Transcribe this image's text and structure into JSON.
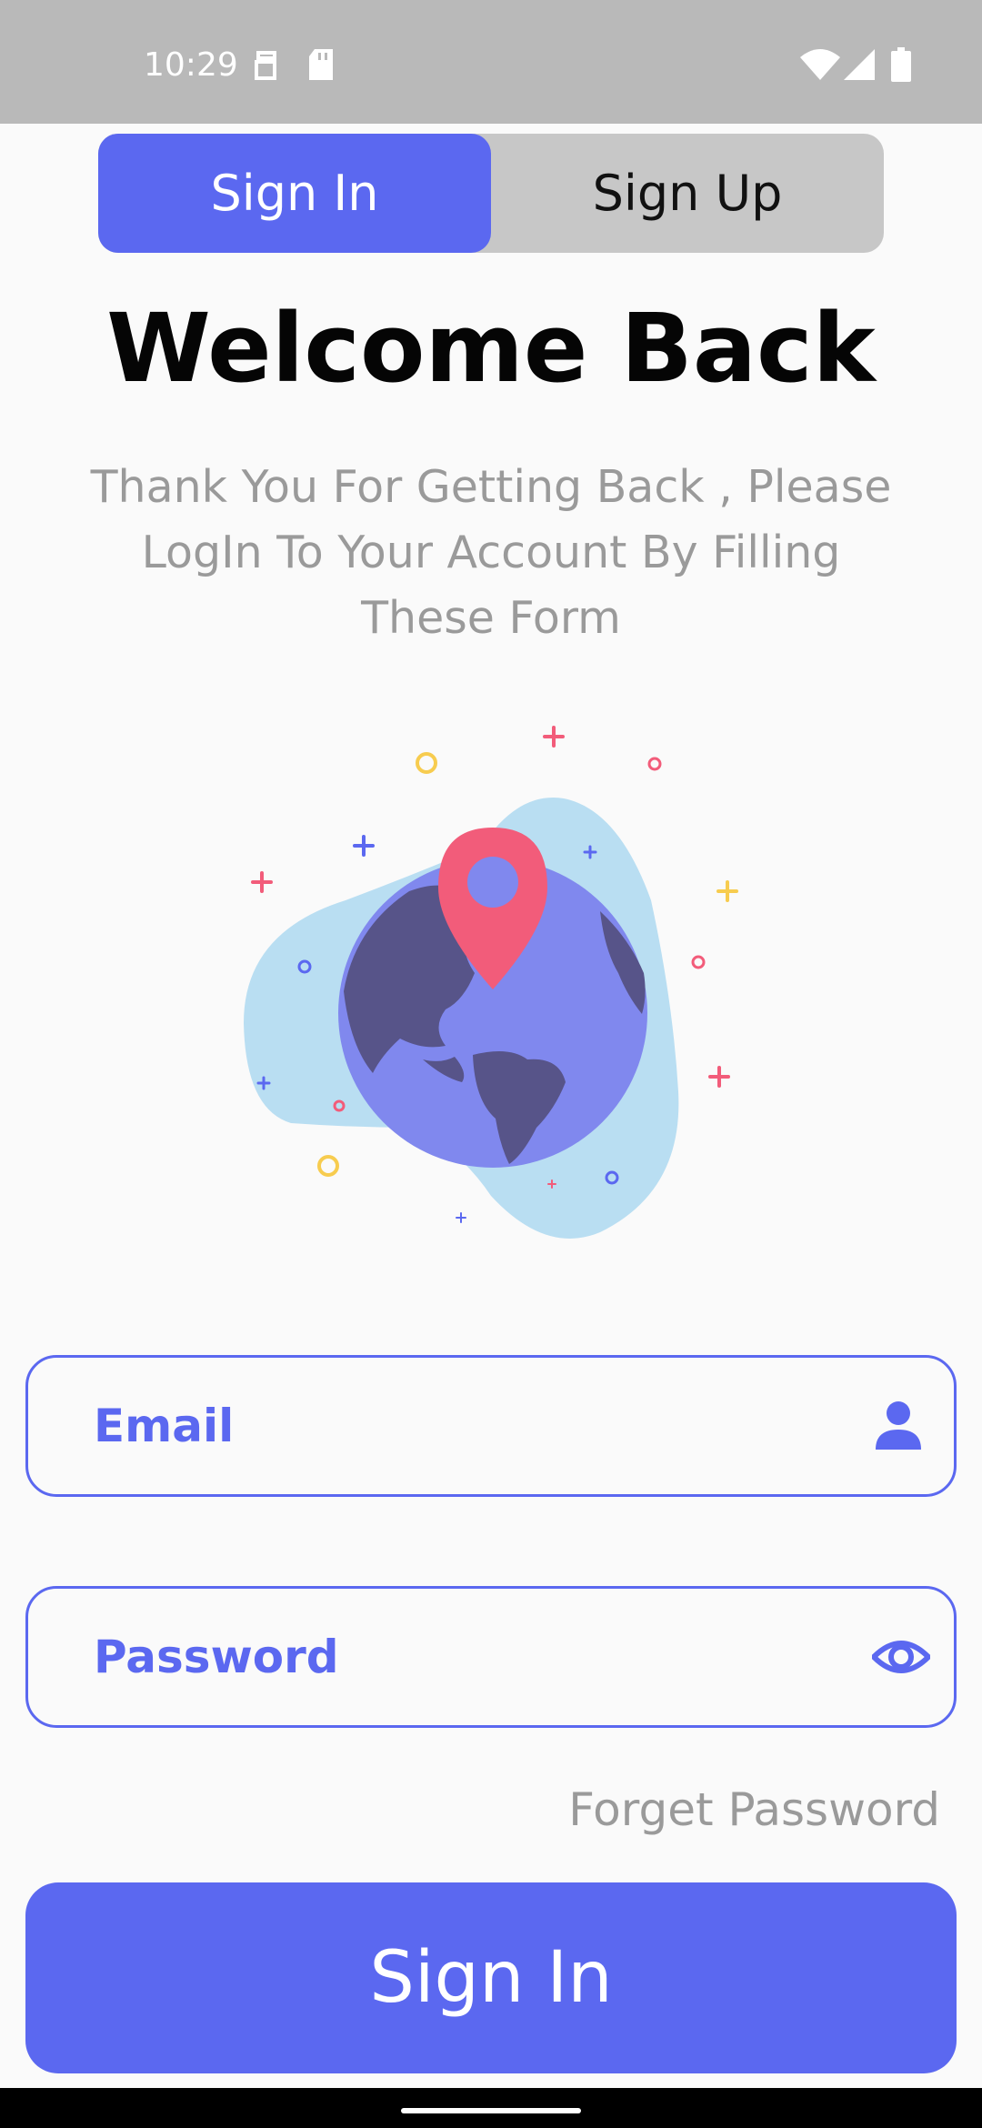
{
  "status_bar": {
    "time": "10:29",
    "icons": [
      "sim-icon",
      "sd-card-icon",
      "wifi-icon",
      "signal-icon",
      "battery-icon"
    ]
  },
  "tabs": [
    {
      "label": "Sign In",
      "active": true
    },
    {
      "label": "Sign Up",
      "active": false
    }
  ],
  "header": {
    "title": "Welcome Back",
    "subtitle": "Thank You For Getting Back , Please LogIn To Your Account By Filling These Form"
  },
  "illustration": {
    "icon": "globe-location-pin-icon"
  },
  "form": {
    "email": {
      "placeholder": "Email",
      "icon": "person-icon"
    },
    "password": {
      "placeholder": "Password",
      "icon": "eye-icon"
    },
    "forget_link": "Forget Password",
    "submit_label": "Sign In"
  },
  "colors": {
    "accent": "#5b68f0",
    "pin": "#f25c7a",
    "globe": "#8088ee",
    "continents": "#575489",
    "blob": "#b9def2",
    "muted_text": "#9a9a9a"
  }
}
